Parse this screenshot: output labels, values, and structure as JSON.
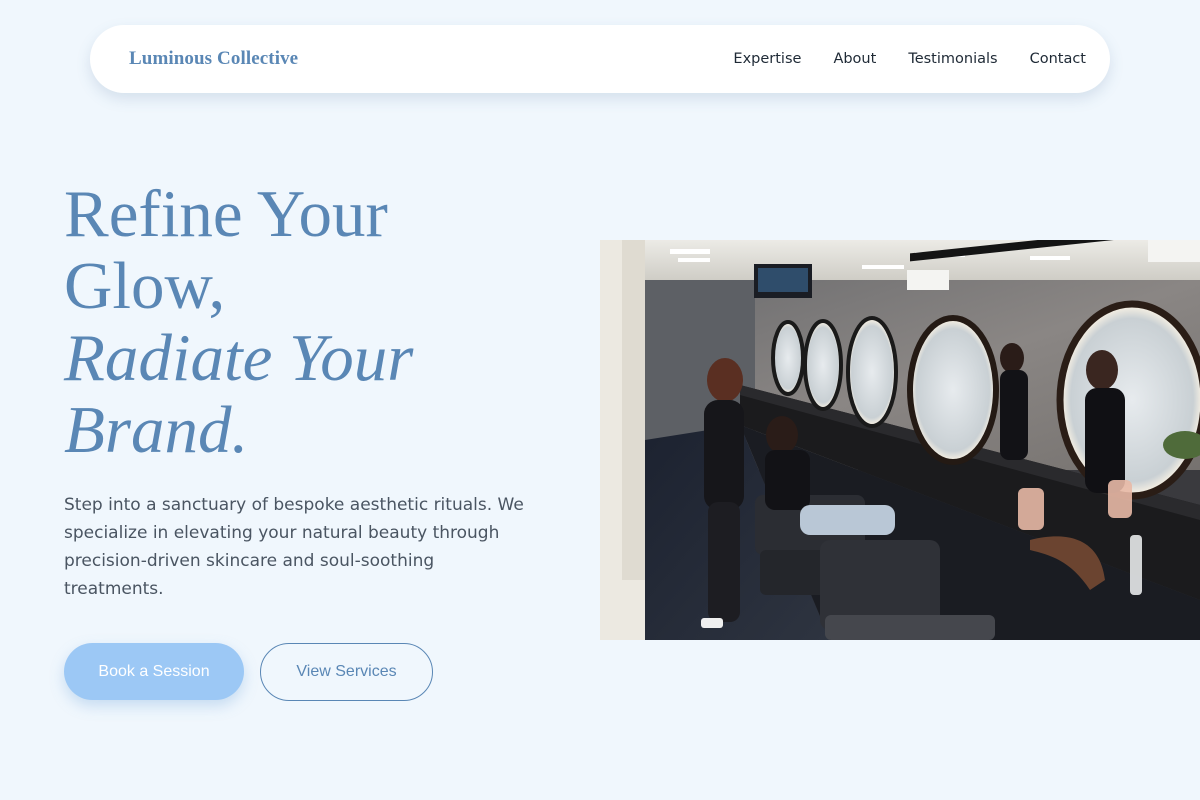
{
  "nav": {
    "brand": "Luminous Collective",
    "links": [
      "Expertise",
      "About",
      "Testimonials",
      "Contact"
    ]
  },
  "hero": {
    "headline": {
      "line1": "Refine Your",
      "line2": "Glow,",
      "line3": "Radiate Your",
      "line4": "Brand."
    },
    "lead": "Step into a sanctuary of bespoke aesthetic rituals. We specialize in elevating your natural beauty through precision-driven skincare and soul-soothing treatments.",
    "primary_button": "Book a Session",
    "secondary_button": "View Services"
  },
  "colors": {
    "background": "#f0f7fd",
    "accent": "#5a87b5",
    "primary_button": "#9cc8f5"
  }
}
